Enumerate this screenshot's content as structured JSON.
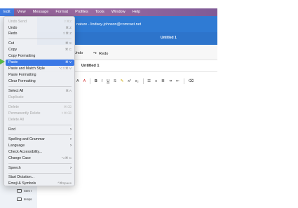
{
  "menubar": {
    "items": [
      "Edit",
      "View",
      "Message",
      "Format",
      "Profiles",
      "Tools",
      "Window",
      "Help"
    ],
    "active": "Edit"
  },
  "compose": {
    "signature": "nature - lindsey-johnson@comcast.net",
    "title": "Untitled 1",
    "undo_label": "Undo",
    "redo_label": "Redo",
    "subject": "Untitled 1",
    "toolbar_glyphs": [
      "A",
      "A",
      "B",
      "I",
      "U",
      "S",
      "x²",
      "x₂"
    ]
  },
  "folders": [
    "Sent I",
    "temps"
  ],
  "menu": {
    "undo_send": {
      "label": "Undo Send",
      "shortcut": "⇧⌘Z"
    },
    "undo": {
      "label": "Undo",
      "shortcut": "⌘ Z"
    },
    "redo": {
      "label": "Redo",
      "shortcut": "⇧⌘ Z"
    },
    "cut": {
      "label": "Cut",
      "shortcut": "⌘ X"
    },
    "copy": {
      "label": "Copy",
      "shortcut": "⌘ C"
    },
    "copy_formatting": {
      "label": "Copy Formatting",
      "shortcut": ""
    },
    "paste": {
      "label": "Paste",
      "shortcut": "⌘ V"
    },
    "paste_match": {
      "label": "Paste and Match Style",
      "shortcut": "⌥⇧⌘ V"
    },
    "paste_formatting": {
      "label": "Paste Formatting",
      "shortcut": ""
    },
    "clear_formatting": {
      "label": "Clear Formatting",
      "shortcut": ""
    },
    "select_all": {
      "label": "Select All",
      "shortcut": "⌘ A"
    },
    "duplicate": {
      "label": "Duplicate",
      "shortcut": ""
    },
    "delete": {
      "label": "Delete",
      "shortcut": "⌘⌫"
    },
    "perm_delete": {
      "label": "Permanently Delete",
      "shortcut": "⇧⌘⌫"
    },
    "delete_all": {
      "label": "Delete All",
      "shortcut": ""
    },
    "find": {
      "label": "Find"
    },
    "spelling": {
      "label": "Spelling and Grammar"
    },
    "language": {
      "label": "Language"
    },
    "accessibility": {
      "label": "Check Accessibility...",
      "shortcut": ""
    },
    "change_case": {
      "label": "Change Case",
      "shortcut": "⌥⌘ C"
    },
    "speech": {
      "label": "Speech"
    },
    "dictation": {
      "label": "Start Dictation...",
      "shortcut": ""
    },
    "emoji": {
      "label": "Emoji & Symbols",
      "shortcut": "^⌘Space"
    }
  }
}
